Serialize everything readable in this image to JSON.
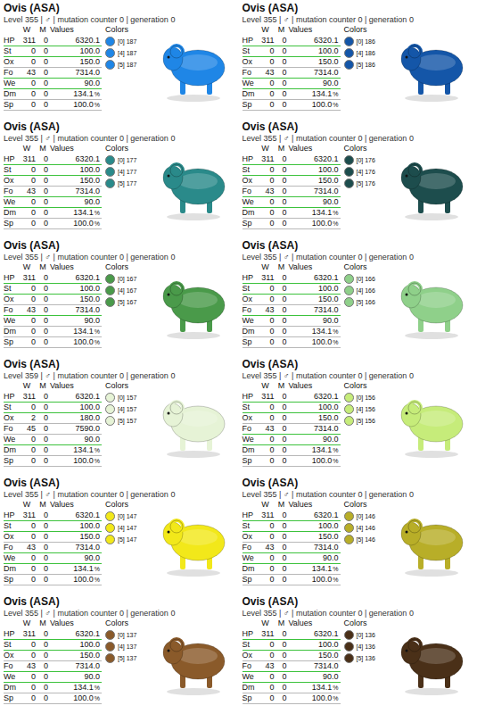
{
  "columns": [
    "W",
    "M",
    "Values"
  ],
  "colors_label": "Colors",
  "cards": [
    {
      "title": "Ovis (ASA)",
      "subtitle": "Level 355 | ♂ | mutation counter 0 | generation 0",
      "color": "#1f86e6",
      "stats": [
        {
          "name": "HP",
          "w": "311",
          "m": "0",
          "value": "6320.1",
          "unit": "",
          "highlighted": true
        },
        {
          "name": "St",
          "w": "0",
          "m": "0",
          "value": "100.0",
          "unit": "",
          "highlighted": true
        },
        {
          "name": "Ox",
          "w": "0",
          "m": "0",
          "value": "150.0",
          "unit": "",
          "highlighted": false
        },
        {
          "name": "Fo",
          "w": "43",
          "m": "0",
          "value": "7314.0",
          "unit": "",
          "highlighted": true
        },
        {
          "name": "We",
          "w": "0",
          "m": "0",
          "value": "90.0",
          "unit": "",
          "highlighted": true
        },
        {
          "name": "Dm",
          "w": "0",
          "m": "0",
          "value": "134.1",
          "unit": "%",
          "highlighted": false
        },
        {
          "name": "Sp",
          "w": "0",
          "m": "0",
          "value": "100.0",
          "unit": "%",
          "highlighted": false
        }
      ],
      "colors": [
        {
          "label": "[0] 187",
          "color": "#1f86e6"
        },
        {
          "label": "[4] 187",
          "color": "#1f86e6"
        },
        {
          "label": "[5] 187",
          "color": "#1f86e6"
        }
      ]
    },
    {
      "title": "Ovis (ASA)",
      "subtitle": "Level 355 | ♂ | mutation counter 0 | generation 0",
      "color": "#1456a8",
      "stats": [
        {
          "name": "HP",
          "w": "311",
          "m": "0",
          "value": "6320.1",
          "unit": "",
          "highlighted": true
        },
        {
          "name": "St",
          "w": "0",
          "m": "0",
          "value": "100.0",
          "unit": "",
          "highlighted": true
        },
        {
          "name": "Ox",
          "w": "0",
          "m": "0",
          "value": "150.0",
          "unit": "",
          "highlighted": false
        },
        {
          "name": "Fo",
          "w": "43",
          "m": "0",
          "value": "7314.0",
          "unit": "",
          "highlighted": true
        },
        {
          "name": "We",
          "w": "0",
          "m": "0",
          "value": "90.0",
          "unit": "",
          "highlighted": true
        },
        {
          "name": "Dm",
          "w": "0",
          "m": "0",
          "value": "134.1",
          "unit": "%",
          "highlighted": false
        },
        {
          "name": "Sp",
          "w": "0",
          "m": "0",
          "value": "100.0",
          "unit": "%",
          "highlighted": false
        }
      ],
      "colors": [
        {
          "label": "[0] 186",
          "color": "#1456a8"
        },
        {
          "label": "[4] 186",
          "color": "#1456a8"
        },
        {
          "label": "[5] 186",
          "color": "#1456a8"
        }
      ]
    },
    {
      "title": "Ovis (ASA)",
      "subtitle": "Level 355 | ♂ | mutation counter 0 | generation 0",
      "color": "#2a8a8a",
      "stats": [
        {
          "name": "HP",
          "w": "311",
          "m": "0",
          "value": "6320.1",
          "unit": "",
          "highlighted": true
        },
        {
          "name": "St",
          "w": "0",
          "m": "0",
          "value": "100.0",
          "unit": "",
          "highlighted": true
        },
        {
          "name": "Ox",
          "w": "0",
          "m": "0",
          "value": "150.0",
          "unit": "",
          "highlighted": false
        },
        {
          "name": "Fo",
          "w": "43",
          "m": "0",
          "value": "7314.0",
          "unit": "",
          "highlighted": true
        },
        {
          "name": "We",
          "w": "0",
          "m": "0",
          "value": "90.0",
          "unit": "",
          "highlighted": true
        },
        {
          "name": "Dm",
          "w": "0",
          "m": "0",
          "value": "134.1",
          "unit": "%",
          "highlighted": false
        },
        {
          "name": "Sp",
          "w": "0",
          "m": "0",
          "value": "100.0",
          "unit": "%",
          "highlighted": false
        }
      ],
      "colors": [
        {
          "label": "[0] 177",
          "color": "#2a8a8a"
        },
        {
          "label": "[4] 177",
          "color": "#2a8a8a"
        },
        {
          "label": "[5] 177",
          "color": "#2a8a8a"
        }
      ]
    },
    {
      "title": "Ovis (ASA)",
      "subtitle": "Level 355 | ♂ | mutation counter 0 | generation 0",
      "color": "#1d4d4d",
      "stats": [
        {
          "name": "HP",
          "w": "311",
          "m": "0",
          "value": "6320.1",
          "unit": "",
          "highlighted": true
        },
        {
          "name": "St",
          "w": "0",
          "m": "0",
          "value": "100.0",
          "unit": "",
          "highlighted": true
        },
        {
          "name": "Ox",
          "w": "0",
          "m": "0",
          "value": "150.0",
          "unit": "",
          "highlighted": false
        },
        {
          "name": "Fo",
          "w": "43",
          "m": "0",
          "value": "7314.0",
          "unit": "",
          "highlighted": true
        },
        {
          "name": "We",
          "w": "0",
          "m": "0",
          "value": "90.0",
          "unit": "",
          "highlighted": true
        },
        {
          "name": "Dm",
          "w": "0",
          "m": "0",
          "value": "134.1",
          "unit": "%",
          "highlighted": false
        },
        {
          "name": "Sp",
          "w": "0",
          "m": "0",
          "value": "100.0",
          "unit": "%",
          "highlighted": false
        }
      ],
      "colors": [
        {
          "label": "[0] 176",
          "color": "#1d4d4d"
        },
        {
          "label": "[4] 176",
          "color": "#1d4d4d"
        },
        {
          "label": "[5] 176",
          "color": "#1d4d4d"
        }
      ]
    },
    {
      "title": "Ovis (ASA)",
      "subtitle": "Level 355 | ♂ | mutation counter 0 | generation 0",
      "color": "#4a9a4a",
      "stats": [
        {
          "name": "HP",
          "w": "311",
          "m": "0",
          "value": "6320.1",
          "unit": "",
          "highlighted": true
        },
        {
          "name": "St",
          "w": "0",
          "m": "0",
          "value": "100.0",
          "unit": "",
          "highlighted": true
        },
        {
          "name": "Ox",
          "w": "0",
          "m": "0",
          "value": "150.0",
          "unit": "",
          "highlighted": false
        },
        {
          "name": "Fo",
          "w": "43",
          "m": "0",
          "value": "7314.0",
          "unit": "",
          "highlighted": true
        },
        {
          "name": "We",
          "w": "0",
          "m": "0",
          "value": "90.0",
          "unit": "",
          "highlighted": false
        },
        {
          "name": "Dm",
          "w": "0",
          "m": "0",
          "value": "134.1",
          "unit": "%",
          "highlighted": false
        },
        {
          "name": "Sp",
          "w": "0",
          "m": "0",
          "value": "100.0",
          "unit": "%",
          "highlighted": false
        }
      ],
      "colors": [
        {
          "label": "[0] 167",
          "color": "#4a9a4a"
        },
        {
          "label": "[4] 167",
          "color": "#4a9a4a"
        },
        {
          "label": "[5] 167",
          "color": "#4a9a4a"
        }
      ]
    },
    {
      "title": "Ovis (ASA)",
      "subtitle": "Level 355 | ♂ | mutation counter 0 | generation 0",
      "color": "#8fd08a",
      "stats": [
        {
          "name": "HP",
          "w": "311",
          "m": "0",
          "value": "6320.1",
          "unit": "",
          "highlighted": true
        },
        {
          "name": "St",
          "w": "0",
          "m": "0",
          "value": "100.0",
          "unit": "",
          "highlighted": true
        },
        {
          "name": "Ox",
          "w": "0",
          "m": "0",
          "value": "150.0",
          "unit": "",
          "highlighted": false
        },
        {
          "name": "Fo",
          "w": "43",
          "m": "0",
          "value": "7314.0",
          "unit": "",
          "highlighted": true
        },
        {
          "name": "We",
          "w": "0",
          "m": "0",
          "value": "90.0",
          "unit": "",
          "highlighted": false
        },
        {
          "name": "Dm",
          "w": "0",
          "m": "0",
          "value": "134.1",
          "unit": "%",
          "highlighted": false
        },
        {
          "name": "Sp",
          "w": "0",
          "m": "0",
          "value": "100.0",
          "unit": "%",
          "highlighted": false
        }
      ],
      "colors": [
        {
          "label": "[0] 166",
          "color": "#8fd08a"
        },
        {
          "label": "[4] 166",
          "color": "#8fd08a"
        },
        {
          "label": "[5] 166",
          "color": "#8fd08a"
        }
      ]
    },
    {
      "title": "Ovis (ASA)",
      "subtitle": "Level 359 | ♂ | mutation counter 0 | generation 0",
      "color": "#e6f3d6",
      "stats": [
        {
          "name": "HP",
          "w": "311",
          "m": "0",
          "value": "6320.1",
          "unit": "",
          "highlighted": true
        },
        {
          "name": "St",
          "w": "0",
          "m": "0",
          "value": "100.0",
          "unit": "",
          "highlighted": true
        },
        {
          "name": "Ox",
          "w": "2",
          "m": "0",
          "value": "180.0",
          "unit": "",
          "highlighted": false
        },
        {
          "name": "Fo",
          "w": "45",
          "m": "0",
          "value": "7590.0",
          "unit": "",
          "highlighted": false
        },
        {
          "name": "We",
          "w": "0",
          "m": "0",
          "value": "90.0",
          "unit": "",
          "highlighted": true
        },
        {
          "name": "Dm",
          "w": "0",
          "m": "0",
          "value": "134.1",
          "unit": "%",
          "highlighted": false
        },
        {
          "name": "Sp",
          "w": "0",
          "m": "0",
          "value": "100.0",
          "unit": "%",
          "highlighted": false
        }
      ],
      "colors": [
        {
          "label": "[0] 157",
          "color": "#e6f3d6"
        },
        {
          "label": "[4] 157",
          "color": "#e6f3d6"
        },
        {
          "label": "[5] 157",
          "color": "#e6f3d6"
        }
      ]
    },
    {
      "title": "Ovis (ASA)",
      "subtitle": "Level 355 | ♂ | mutation counter 0 | generation 0",
      "color": "#c6ec7a",
      "stats": [
        {
          "name": "HP",
          "w": "311",
          "m": "0",
          "value": "6320.1",
          "unit": "",
          "highlighted": true
        },
        {
          "name": "St",
          "w": "0",
          "m": "0",
          "value": "100.0",
          "unit": "",
          "highlighted": true
        },
        {
          "name": "Ox",
          "w": "0",
          "m": "0",
          "value": "150.0",
          "unit": "",
          "highlighted": false
        },
        {
          "name": "Fo",
          "w": "43",
          "m": "0",
          "value": "7314.0",
          "unit": "",
          "highlighted": true
        },
        {
          "name": "We",
          "w": "0",
          "m": "0",
          "value": "90.0",
          "unit": "",
          "highlighted": true
        },
        {
          "name": "Dm",
          "w": "0",
          "m": "0",
          "value": "134.1",
          "unit": "%",
          "highlighted": false
        },
        {
          "name": "Sp",
          "w": "0",
          "m": "0",
          "value": "100.0",
          "unit": "%",
          "highlighted": false
        }
      ],
      "colors": [
        {
          "label": "[0] 156",
          "color": "#c6ec7a"
        },
        {
          "label": "[4] 156",
          "color": "#c6ec7a"
        },
        {
          "label": "[5] 156",
          "color": "#c6ec7a"
        }
      ]
    },
    {
      "title": "Ovis (ASA)",
      "subtitle": "Level 355 | ♂ | mutation counter 0 | generation 0",
      "color": "#f2e81a",
      "stats": [
        {
          "name": "HP",
          "w": "311",
          "m": "0",
          "value": "6320.1",
          "unit": "",
          "highlighted": true
        },
        {
          "name": "St",
          "w": "0",
          "m": "0",
          "value": "100.0",
          "unit": "",
          "highlighted": true
        },
        {
          "name": "Ox",
          "w": "0",
          "m": "0",
          "value": "150.0",
          "unit": "",
          "highlighted": false
        },
        {
          "name": "Fo",
          "w": "43",
          "m": "0",
          "value": "7314.0",
          "unit": "",
          "highlighted": true
        },
        {
          "name": "We",
          "w": "0",
          "m": "0",
          "value": "90.0",
          "unit": "",
          "highlighted": true
        },
        {
          "name": "Dm",
          "w": "0",
          "m": "0",
          "value": "134.1",
          "unit": "%",
          "highlighted": false
        },
        {
          "name": "Sp",
          "w": "0",
          "m": "0",
          "value": "100.0",
          "unit": "%",
          "highlighted": false
        }
      ],
      "colors": [
        {
          "label": "[0] 147",
          "color": "#f2e81a"
        },
        {
          "label": "[4] 147",
          "color": "#f2e81a"
        },
        {
          "label": "[5] 147",
          "color": "#f2e81a"
        }
      ]
    },
    {
      "title": "Ovis (ASA)",
      "subtitle": "Level 355 | ♂ | mutation counter 0 | generation 0",
      "color": "#b8ae28",
      "stats": [
        {
          "name": "HP",
          "w": "311",
          "m": "0",
          "value": "6320.1",
          "unit": "",
          "highlighted": true
        },
        {
          "name": "St",
          "w": "0",
          "m": "0",
          "value": "100.0",
          "unit": "",
          "highlighted": true
        },
        {
          "name": "Ox",
          "w": "0",
          "m": "0",
          "value": "150.0",
          "unit": "",
          "highlighted": false
        },
        {
          "name": "Fo",
          "w": "43",
          "m": "0",
          "value": "7314.0",
          "unit": "",
          "highlighted": true
        },
        {
          "name": "We",
          "w": "0",
          "m": "0",
          "value": "90.0",
          "unit": "",
          "highlighted": true
        },
        {
          "name": "Dm",
          "w": "0",
          "m": "0",
          "value": "134.1",
          "unit": "%",
          "highlighted": false
        },
        {
          "name": "Sp",
          "w": "0",
          "m": "0",
          "value": "100.0",
          "unit": "%",
          "highlighted": false
        }
      ],
      "colors": [
        {
          "label": "[0] 146",
          "color": "#b8ae28"
        },
        {
          "label": "[4] 146",
          "color": "#b8ae28"
        },
        {
          "label": "[5] 146",
          "color": "#b8ae28"
        }
      ]
    },
    {
      "title": "Ovis (ASA)",
      "subtitle": "Level 355 | ♂ | mutation counter 0 | generation 0",
      "color": "#8a5a2a",
      "stats": [
        {
          "name": "HP",
          "w": "311",
          "m": "0",
          "value": "6320.1",
          "unit": "",
          "highlighted": true
        },
        {
          "name": "St",
          "w": "0",
          "m": "0",
          "value": "100.0",
          "unit": "",
          "highlighted": true
        },
        {
          "name": "Ox",
          "w": "0",
          "m": "0",
          "value": "150.0",
          "unit": "",
          "highlighted": false
        },
        {
          "name": "Fo",
          "w": "43",
          "m": "0",
          "value": "7314.0",
          "unit": "",
          "highlighted": true
        },
        {
          "name": "We",
          "w": "0",
          "m": "0",
          "value": "90.0",
          "unit": "",
          "highlighted": true
        },
        {
          "name": "Dm",
          "w": "0",
          "m": "0",
          "value": "134.1",
          "unit": "%",
          "highlighted": false
        },
        {
          "name": "Sp",
          "w": "0",
          "m": "0",
          "value": "100.0",
          "unit": "%",
          "highlighted": false
        }
      ],
      "colors": [
        {
          "label": "[0] 137",
          "color": "#8a5a2a"
        },
        {
          "label": "[4] 137",
          "color": "#8a5a2a"
        },
        {
          "label": "[5] 137",
          "color": "#8a5a2a"
        }
      ]
    },
    {
      "title": "Ovis (ASA)",
      "subtitle": "Level 355 | ♂ | mutation counter 0 | generation 0",
      "color": "#4a3018",
      "stats": [
        {
          "name": "HP",
          "w": "311",
          "m": "0",
          "value": "6320.1",
          "unit": "",
          "highlighted": true
        },
        {
          "name": "St",
          "w": "0",
          "m": "0",
          "value": "100.0",
          "unit": "",
          "highlighted": true
        },
        {
          "name": "Ox",
          "w": "0",
          "m": "0",
          "value": "150.0",
          "unit": "",
          "highlighted": false
        },
        {
          "name": "Fo",
          "w": "43",
          "m": "0",
          "value": "7314.0",
          "unit": "",
          "highlighted": true
        },
        {
          "name": "We",
          "w": "0",
          "m": "0",
          "value": "90.0",
          "unit": "",
          "highlighted": true
        },
        {
          "name": "Dm",
          "w": "0",
          "m": "0",
          "value": "134.1",
          "unit": "%",
          "highlighted": false
        },
        {
          "name": "Sp",
          "w": "0",
          "m": "0",
          "value": "100.0",
          "unit": "%",
          "highlighted": false
        }
      ],
      "colors": [
        {
          "label": "[0] 136",
          "color": "#4a3018"
        },
        {
          "label": "[4] 136",
          "color": "#4a3018"
        },
        {
          "label": "[5] 136",
          "color": "#4a3018"
        }
      ]
    }
  ]
}
